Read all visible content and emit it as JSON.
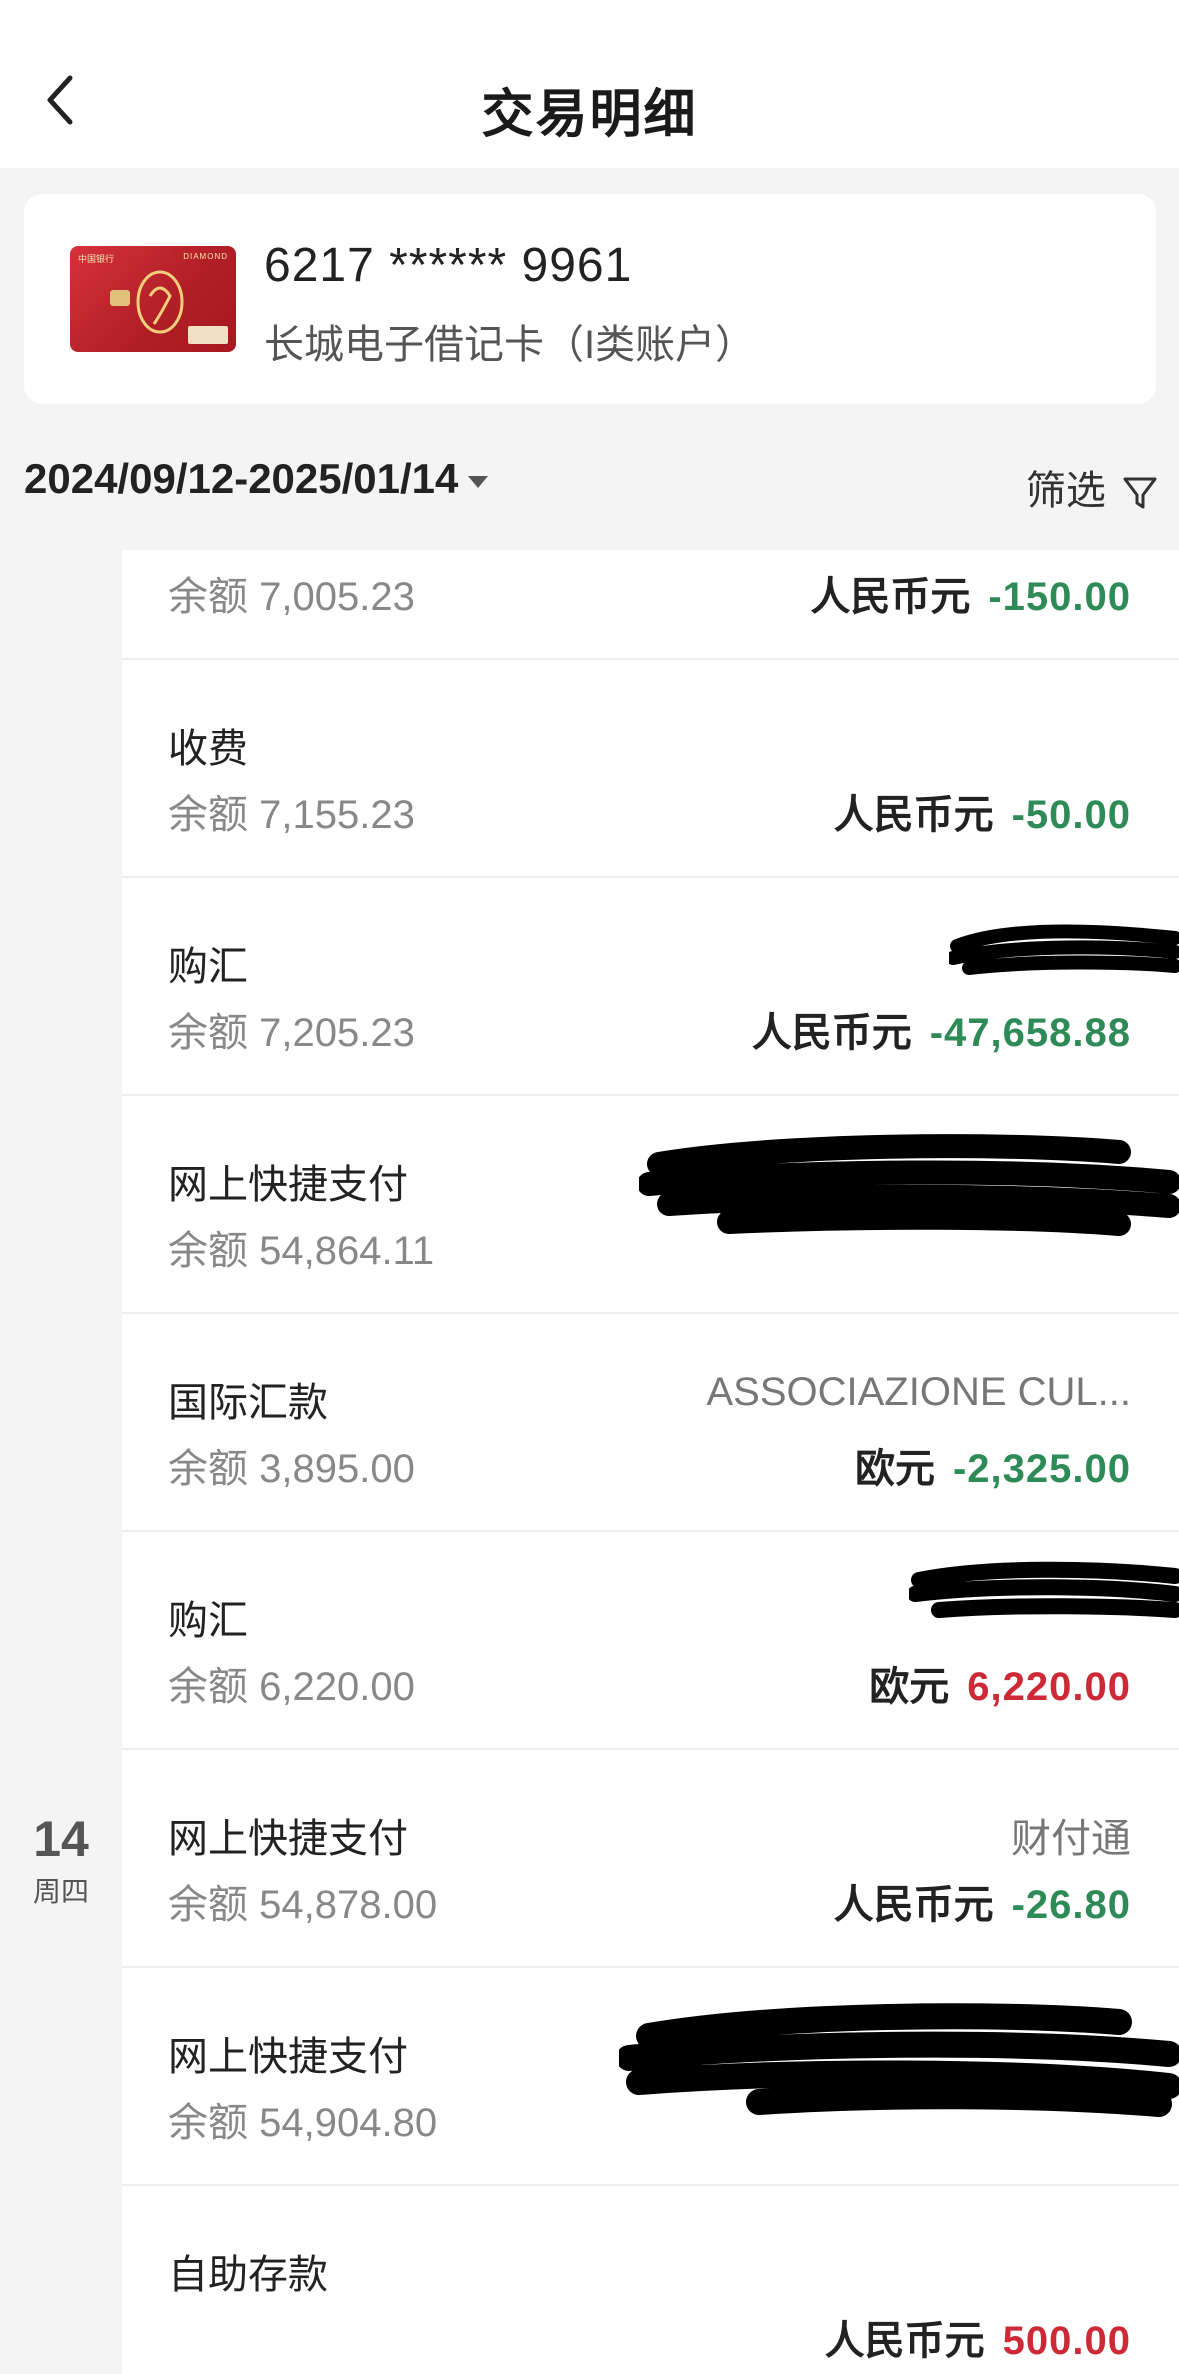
{
  "header": {
    "title": "交易明细"
  },
  "card": {
    "number": "6217 ****** 9961",
    "type": "长城电子借记卡（I类账户）"
  },
  "filter": {
    "date_range": "2024/09/12-2025/01/14",
    "filter_label": "筛选"
  },
  "day": {
    "number": "14",
    "weekday": "周四"
  },
  "colors": {
    "negative": "#2e8b57",
    "positive": "#cc2a36"
  },
  "transactions": [
    {
      "type": "",
      "balance": "余额 7,005.23",
      "merchant": "",
      "currency": "人民币元",
      "amount": "-150.00",
      "direction": "negative"
    },
    {
      "type": "收费",
      "balance": "余额 7,155.23",
      "merchant": "",
      "currency": "人民币元",
      "amount": "-50.00",
      "direction": "negative"
    },
    {
      "type": "购汇",
      "balance": "余额 7,205.23",
      "merchant": "",
      "currency": "人民币元",
      "amount": "-47,658.88",
      "direction": "negative"
    },
    {
      "type": "网上快捷支付",
      "balance": "余额 54,864.11",
      "merchant": "",
      "currency": "",
      "amount": "",
      "direction": "negative"
    },
    {
      "type": "国际汇款",
      "balance": "余额 3,895.00",
      "merchant": "ASSOCIAZIONE CUL...",
      "currency": "欧元",
      "amount": "-2,325.00",
      "direction": "negative"
    },
    {
      "type": "购汇",
      "balance": "余额 6,220.00",
      "merchant": "",
      "currency": "欧元",
      "amount": "6,220.00",
      "direction": "positive"
    },
    {
      "type": "网上快捷支付",
      "balance": "余额 54,878.00",
      "merchant": "财付通",
      "currency": "人民币元",
      "amount": "-26.80",
      "direction": "negative"
    },
    {
      "type": "网上快捷支付",
      "balance": "余额 54,904.80",
      "merchant": "",
      "currency": "",
      "amount": "",
      "direction": "negative"
    },
    {
      "type": "自助存款",
      "balance": "",
      "merchant": "",
      "currency": "人民币元",
      "amount": "500.00",
      "direction": "positive"
    }
  ]
}
